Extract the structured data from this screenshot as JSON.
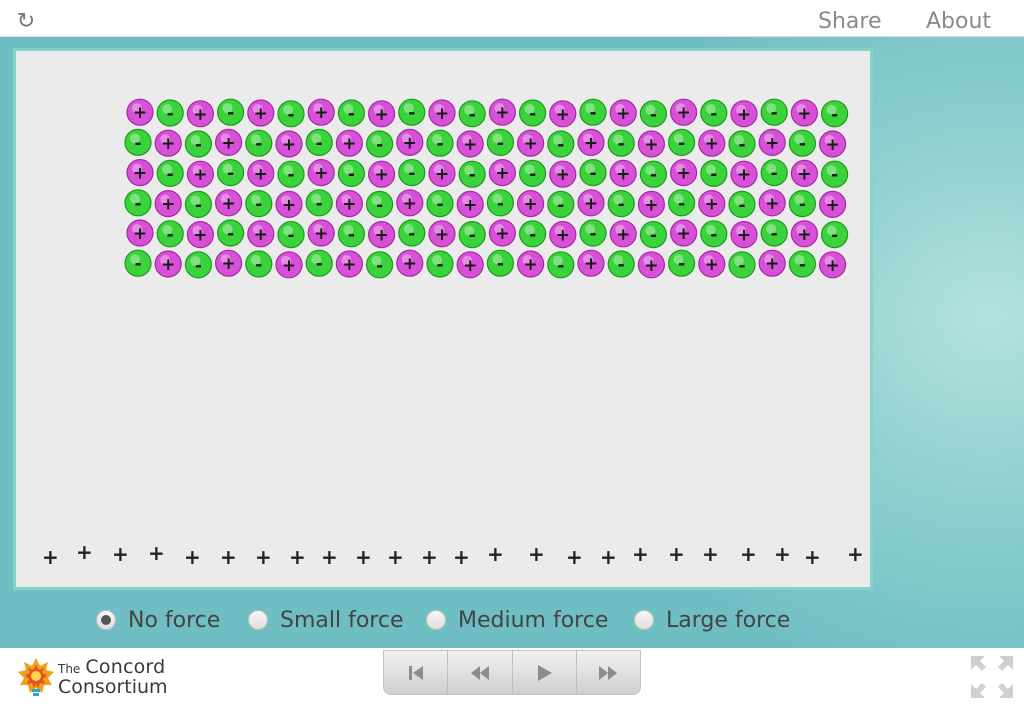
{
  "header": {
    "reload_icon": "reload-icon",
    "share_label": "Share",
    "about_label": "About"
  },
  "simulation": {
    "particle_grid": {
      "rows": 6,
      "columns": 24,
      "positive_color": "#d84fd8",
      "negative_color": "#3bd33b",
      "positive_symbol": "+",
      "negative_symbol": "-",
      "row_start_signs": [
        "+",
        "-",
        "+",
        "-",
        "+",
        "-"
      ]
    },
    "bottom_plate": {
      "symbol": "+",
      "count": 24
    },
    "background_color": "#ebebeb",
    "border_color": "#85d3c6"
  },
  "force_options": {
    "selected": "No force",
    "options": [
      {
        "label": "No force",
        "selected": true
      },
      {
        "label": "Small force",
        "selected": false
      },
      {
        "label": "Medium force",
        "selected": false
      },
      {
        "label": "Large force",
        "selected": false
      }
    ]
  },
  "footer": {
    "logo_line1": "The",
    "logo_line1b": "Concord",
    "logo_line2": "Consortium",
    "player_buttons": [
      {
        "name": "reset-icon",
        "glyph": "⏮"
      },
      {
        "name": "step-back-icon",
        "glyph": "⏪"
      },
      {
        "name": "play-icon",
        "glyph": "▶"
      },
      {
        "name": "step-forward-icon",
        "glyph": "⏩"
      }
    ],
    "fullscreen_icon": "fullscreen-icon"
  }
}
